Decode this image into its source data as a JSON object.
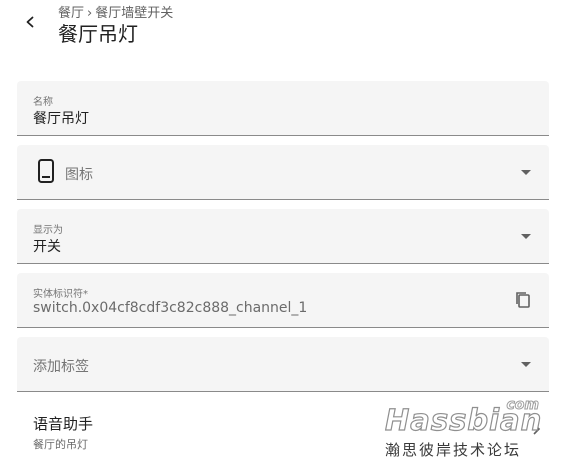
{
  "header": {
    "breadcrumb_parent": "餐厅",
    "breadcrumb_separator": "›",
    "breadcrumb_current": "餐厅墙壁开关",
    "title": "餐厅吊灯"
  },
  "fields": {
    "name": {
      "label": "名称",
      "value": "餐厅吊灯"
    },
    "icon": {
      "placeholder": "图标",
      "icon": "cellphone-icon"
    },
    "show_as": {
      "label": "显示为",
      "value": "开关"
    },
    "entity_id": {
      "label": "实体标识符*",
      "value": "switch.0x04cf8cdf3c82c888_channel_1"
    },
    "labels": {
      "placeholder": "添加标签"
    }
  },
  "voice_assistant": {
    "title": "语音助手",
    "subtitle": "餐厅的吊灯"
  },
  "watermark": {
    "com": "com",
    "brand": "Hassbian",
    "subtitle": "瀚思彼岸技术论坛"
  }
}
